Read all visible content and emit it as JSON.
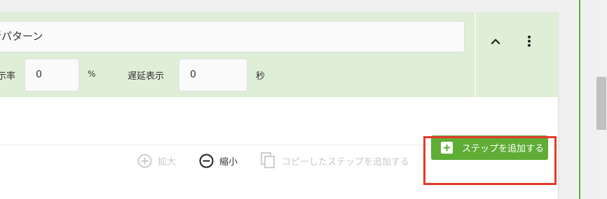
{
  "pattern": {
    "name_value": "新パターン"
  },
  "settings": {
    "rate_label": "表示率",
    "rate_label_visible": "示率",
    "rate_value": "0",
    "rate_unit": "%",
    "delay_label": "遅延表示",
    "delay_value": "0",
    "delay_unit": "秒"
  },
  "header_actions": {
    "collapse_icon": "chevron-up-icon",
    "more_icon": "more-vertical-icon"
  },
  "toolbar": {
    "zoom_in_label": "拡大",
    "zoom_out_label": "縮小",
    "add_copied_label": "コピーしたステップを追加する",
    "add_step_label": "ステップを追加する"
  },
  "colors": {
    "header_bg": "#dfeed7",
    "accent_green": "#5fad35",
    "highlight_red": "#e53a2b",
    "disabled_text": "#c8c8c8"
  }
}
